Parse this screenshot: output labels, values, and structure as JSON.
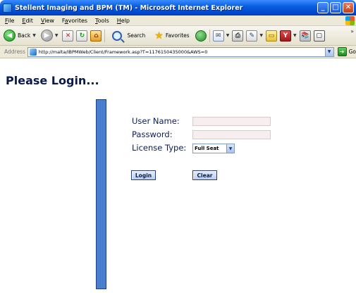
{
  "window": {
    "title": "Stellent Imaging and BPM (TM) - Microsoft Internet Explorer",
    "minimize": "_",
    "maximize": "□",
    "close": "✕"
  },
  "menubar": {
    "items": [
      {
        "label": "File",
        "key": "F",
        "rest": "ile"
      },
      {
        "label": "Edit",
        "key": "E",
        "rest": "dit"
      },
      {
        "label": "View",
        "key": "V",
        "rest": "iew"
      },
      {
        "label": "Favorites",
        "key": "a",
        "pre": "F",
        "rest": "vorites"
      },
      {
        "label": "Tools",
        "key": "T",
        "rest": "ools"
      },
      {
        "label": "Help",
        "key": "H",
        "rest": "elp"
      }
    ]
  },
  "toolbar": {
    "back_label": "Back",
    "search_label": "Search",
    "favorites_label": "Favorites",
    "icons": [
      "back-icon",
      "forward-icon",
      "stop-icon",
      "refresh-icon",
      "home-icon",
      "search-icon",
      "favorites-star-icon",
      "media-icon",
      "mail-icon",
      "print-icon",
      "edit-icon",
      "folder-icon",
      "messenger-icon",
      "research-icon",
      "fullscreen-icon"
    ]
  },
  "address": {
    "label": "Address",
    "url": "http://malta/IBPMWeb/Client/Framework.asp?T=1176150435000&AWS=0",
    "go_label": "Go"
  },
  "page": {
    "title": "Please Login...",
    "form": {
      "username_label": "User Name:",
      "username_value": "",
      "password_label": "Password:",
      "password_value": "",
      "license_label": "License Type:",
      "license_selected": "Full Seat",
      "login_label": "Login",
      "clear_label": "Clear"
    }
  },
  "colors": {
    "titlebar": "#0a5fe0",
    "accent_bar": "#4a7fcf",
    "heading_text": "#0c1a4a",
    "input_bg": "#f7eef0"
  }
}
